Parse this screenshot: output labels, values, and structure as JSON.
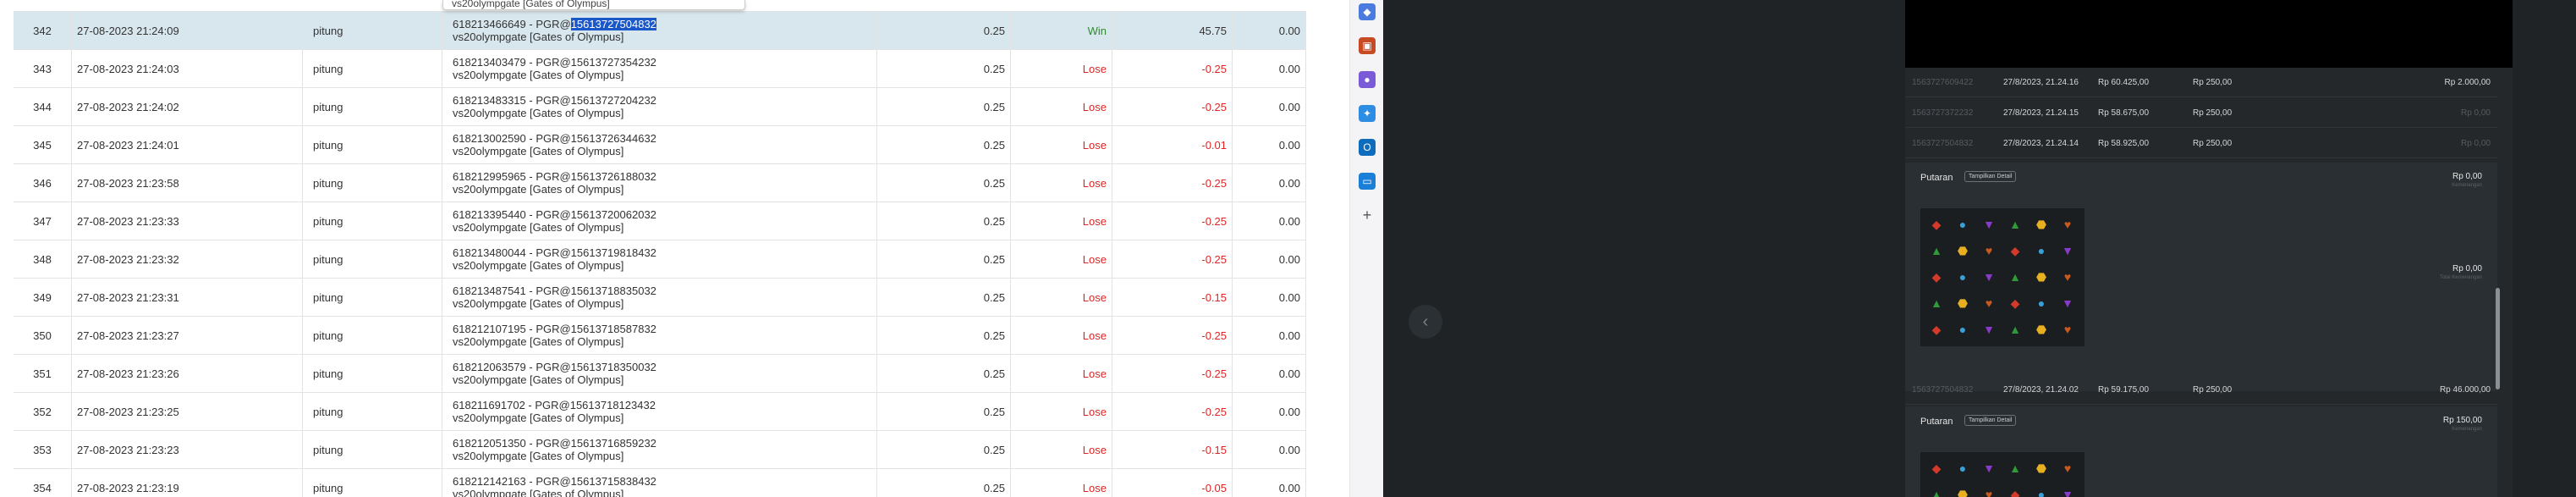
{
  "table": {
    "tooltip_text": "vs20olympgate [Gates of Olympus]",
    "top_row_partial_text": "vs20olympgate [Gates of Olympus]",
    "highlighted_part": "15613727504832",
    "rows": [
      {
        "no": "342",
        "datetime": "27-08-2023 21:24:09",
        "user": "pitung",
        "desc1_prefix": "618213466649 - PGR@",
        "desc1_sel": "15613727504832",
        "desc2": "vs20olympgate [Gates of Olympus]",
        "bet": "0.25",
        "status": "Win",
        "winlose": "45.75",
        "balance": "0.00",
        "selected": true
      },
      {
        "no": "343",
        "datetime": "27-08-2023 21:24:03",
        "user": "pitung",
        "desc1": "618213403479 - PGR@15613727354232",
        "desc2": "vs20olympgate [Gates of Olympus]",
        "bet": "0.25",
        "status": "Lose",
        "winlose": "-0.25",
        "balance": "0.00"
      },
      {
        "no": "344",
        "datetime": "27-08-2023 21:24:02",
        "user": "pitung",
        "desc1": "618213483315 - PGR@15613727204232",
        "desc2": "vs20olympgate [Gates of Olympus]",
        "bet": "0.25",
        "status": "Lose",
        "winlose": "-0.25",
        "balance": "0.00"
      },
      {
        "no": "345",
        "datetime": "27-08-2023 21:24:01",
        "user": "pitung",
        "desc1": "618213002590 - PGR@15613726344632",
        "desc2": "vs20olympgate [Gates of Olympus]",
        "bet": "0.25",
        "status": "Lose",
        "winlose": "-0.01",
        "balance": "0.00"
      },
      {
        "no": "346",
        "datetime": "27-08-2023 21:23:58",
        "user": "pitung",
        "desc1": "618212995965 - PGR@15613726188032",
        "desc2": "vs20olympgate [Gates of Olympus]",
        "bet": "0.25",
        "status": "Lose",
        "winlose": "-0.25",
        "balance": "0.00"
      },
      {
        "no": "347",
        "datetime": "27-08-2023 21:23:33",
        "user": "pitung",
        "desc1": "618213395440 - PGR@15613720062032",
        "desc2": "vs20olympgate [Gates of Olympus]",
        "bet": "0.25",
        "status": "Lose",
        "winlose": "-0.25",
        "balance": "0.00"
      },
      {
        "no": "348",
        "datetime": "27-08-2023 21:23:32",
        "user": "pitung",
        "desc1": "618213480044 - PGR@15613719818432",
        "desc2": "vs20olympgate [Gates of Olympus]",
        "bet": "0.25",
        "status": "Lose",
        "winlose": "-0.25",
        "balance": "0.00"
      },
      {
        "no": "349",
        "datetime": "27-08-2023 21:23:31",
        "user": "pitung",
        "desc1": "618213487541 - PGR@15613718835032",
        "desc2": "vs20olympgate [Gates of Olympus]",
        "bet": "0.25",
        "status": "Lose",
        "winlose": "-0.15",
        "balance": "0.00"
      },
      {
        "no": "350",
        "datetime": "27-08-2023 21:23:27",
        "user": "pitung",
        "desc1": "618212107195 - PGR@15613718587832",
        "desc2": "vs20olympgate [Gates of Olympus]",
        "bet": "0.25",
        "status": "Lose",
        "winlose": "-0.25",
        "balance": "0.00"
      },
      {
        "no": "351",
        "datetime": "27-08-2023 21:23:26",
        "user": "pitung",
        "desc1": "618212063579 - PGR@15613718350032",
        "desc2": "vs20olympgate [Gates of Olympus]",
        "bet": "0.25",
        "status": "Lose",
        "winlose": "-0.25",
        "balance": "0.00"
      },
      {
        "no": "352",
        "datetime": "27-08-2023 21:23:25",
        "user": "pitung",
        "desc1": "618211691702 - PGR@15613718123432",
        "desc2": "vs20olympgate [Gates of Olympus]",
        "bet": "0.25",
        "status": "Lose",
        "winlose": "-0.25",
        "balance": "0.00"
      },
      {
        "no": "353",
        "datetime": "27-08-2023 21:23:23",
        "user": "pitung",
        "desc1": "618212051350 - PGR@15613716859232",
        "desc2": "vs20olympgate [Gates of Olympus]",
        "bet": "0.25",
        "status": "Lose",
        "winlose": "-0.15",
        "balance": "0.00"
      },
      {
        "no": "354",
        "datetime": "27-08-2023 21:23:19",
        "user": "pitung",
        "desc1": "618212142163 - PGR@15613715838432",
        "desc2": "vs20olympgate [Gates of Olympus]",
        "bet": "0.25",
        "status": "Lose",
        "winlose": "-0.05",
        "balance": "0.00"
      }
    ]
  },
  "sidebar": {
    "icons": [
      "tag-icon",
      "toolbox-icon",
      "people-icon",
      "copilot-icon",
      "outlook-icon",
      "shopping-cart-icon",
      "add-icon"
    ],
    "colors": [
      "#4c7be0",
      "#c84a23",
      "#7a5ad6",
      "#2d8de3",
      "#0f6cbd",
      "#1b7fd8",
      "#444444"
    ]
  },
  "history": {
    "rows_top": [
      {
        "id": "1563727609422",
        "datetime": "27/8/2023, 21.24.16",
        "balance": "Rp 60.425,00",
        "bet": "Rp 250,00",
        "win": "Rp 2.000,00"
      },
      {
        "id": "1563727372232",
        "datetime": "27/8/2023, 21.24.15",
        "balance": "Rp 58.675,00",
        "bet": "Rp 250,00",
        "win": "Rp 0,00"
      },
      {
        "id": "1563727504832",
        "datetime": "27/8/2023, 21.24.14",
        "balance": "Rp 58.925,00",
        "bet": "Rp 250,00",
        "win": "Rp 0,00"
      }
    ],
    "spin_title": "Putaran",
    "spin_button": "Tampilkan Detail",
    "spin1_amount": "Rp 0,00",
    "spin1_sub": "Kemenangan",
    "spin1_amount2": "Rp 0,00",
    "spin1_sub2": "Total Kemenangan",
    "row_mid": {
      "id": "1563727504832",
      "datetime": "27/8/2023, 21.24.02",
      "balance": "Rp 59.175,00",
      "bet": "Rp 250,00",
      "win": "Rp 46.000,00"
    },
    "spin2_amount": "Rp 150,00",
    "spin2_sub": "Kemenangan",
    "gem_colors": [
      "#d43a2a",
      "#3aa0d8",
      "#8a3ac8",
      "#2f9a3a",
      "#e8b020",
      "#c85a20"
    ],
    "gem_glyphs": [
      "◆",
      "●",
      "▼",
      "▲",
      "⬣",
      "♥"
    ]
  }
}
